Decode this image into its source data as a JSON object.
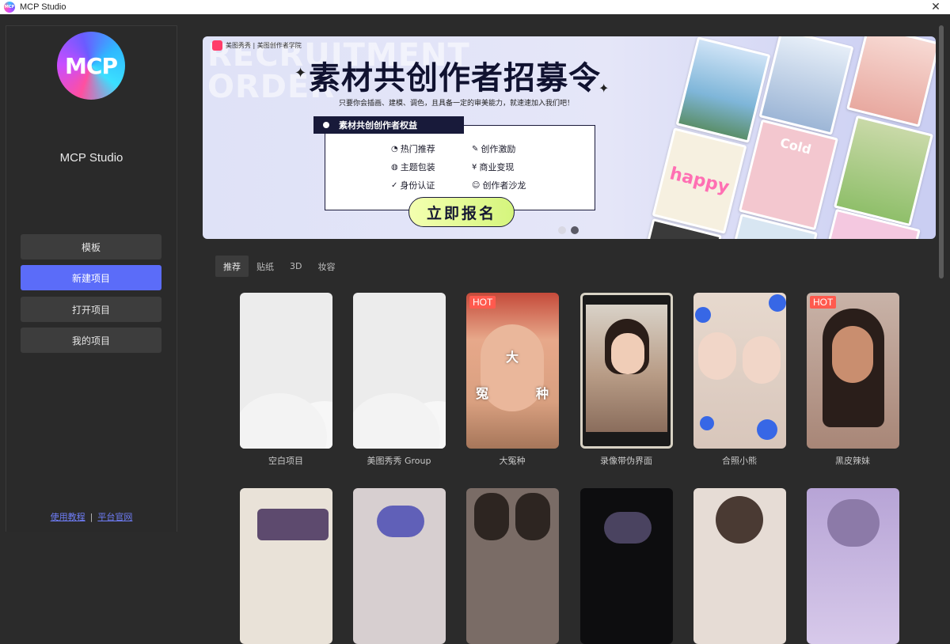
{
  "window": {
    "title": "MCP Studio",
    "logo_text": "MCP"
  },
  "sidebar": {
    "logo_text": "MCP",
    "app_name": "MCP Studio",
    "nav": [
      {
        "label": "模板"
      },
      {
        "label": "新建项目"
      },
      {
        "label": "打开项目"
      },
      {
        "label": "我的项目"
      }
    ],
    "footer": {
      "tutorial": "使用教程",
      "separator": "|",
      "website": "平台官网"
    }
  },
  "banner": {
    "brand": "美图秀秀 | 美图创作者学院",
    "bg_text": "RECRUITMENT ORDER",
    "title": "素材共创作者招募令",
    "subtitle": "只要你会插画、建模、调色，且具备一定的审美能力，就速速加入我们吧！",
    "benefits_header": "素材共创创作者权益",
    "benefits": [
      "热门推荐",
      "创作激励",
      "主题包装",
      "商业变现",
      "身份认证",
      "创作者沙龙"
    ],
    "cta": "立即报名",
    "collage_text": [
      "happy",
      "Cold"
    ],
    "dots": 2,
    "active_dot": 1
  },
  "tabs": [
    {
      "label": "推荐"
    },
    {
      "label": "贴纸"
    },
    {
      "label": "3D"
    },
    {
      "label": "妆容"
    }
  ],
  "templates": [
    {
      "label": "空白项目",
      "hot": ""
    },
    {
      "label": "美图秀秀 Group",
      "hot": ""
    },
    {
      "label": "大冤种",
      "hot": "HOT",
      "overlay": [
        "大",
        "冤",
        "种"
      ]
    },
    {
      "label": "录像带伪界面",
      "hot": ""
    },
    {
      "label": "合照小熊",
      "hot": ""
    },
    {
      "label": "黑皮辣妹",
      "hot": "HOT"
    }
  ],
  "colors": {
    "accent": "#5b6cf9",
    "hot_badge": "#ff5a4e",
    "link": "#6f7df7"
  }
}
